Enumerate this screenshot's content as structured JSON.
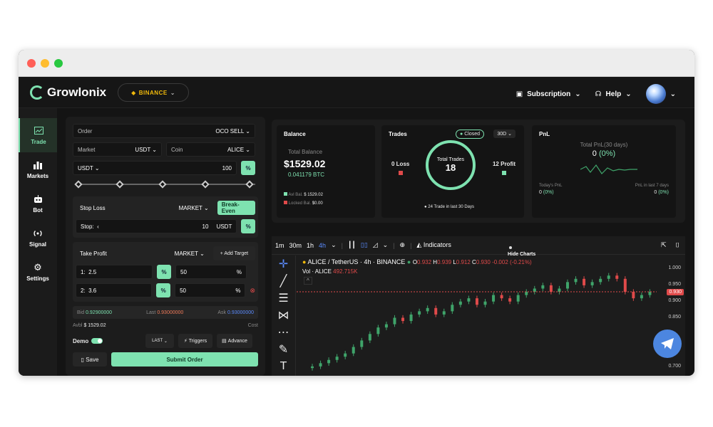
{
  "brand": {
    "name": "Growlonix",
    "exchange": "BINANCE"
  },
  "topbar": {
    "subscription": "Subscription",
    "help": "Help"
  },
  "nav": [
    {
      "label": "Trade",
      "icon": "chart-icon",
      "active": true
    },
    {
      "label": "Markets",
      "icon": "bar-chart-icon",
      "active": false
    },
    {
      "label": "Bot",
      "icon": "robot-icon",
      "active": false
    },
    {
      "label": "Signal",
      "icon": "signal-icon",
      "active": false
    },
    {
      "label": "Settings",
      "icon": "gear-icon",
      "active": false
    }
  ],
  "order": {
    "order_label": "Order",
    "order_type": "OCO SELL",
    "market_label": "Market",
    "market_value": "USDT",
    "coin_label": "Coin",
    "coin_value": "ALICE",
    "amount_unit": "USDT",
    "amount_value": "100",
    "pct": "%",
    "stop_loss_label": "Stop Loss",
    "stop_loss_type": "MARKET",
    "break_even": "Break-Even",
    "stop_label": "Stop:",
    "stop_value": "10",
    "stop_unit": "USDT",
    "take_profit_label": "Take Profit",
    "take_profit_type": "MARKET",
    "add_target": "+ Add Target",
    "targets": [
      {
        "idx": "1:",
        "price": "2.5",
        "amount": "50"
      },
      {
        "idx": "2:",
        "price": "3.6",
        "amount": "50"
      }
    ],
    "bid_label": "Bid",
    "bid": "0.92900000",
    "last_label": "Last",
    "last": "0.93000000",
    "ask_label": "Ask",
    "ask": "0.93000000",
    "avbl_label": "Avbl",
    "avbl": "$ 1529.02",
    "cost_label": "Cost",
    "demo": "Demo",
    "last_btn": "LAST",
    "triggers": "Triggers",
    "advance": "Advance",
    "save": "Save",
    "submit": "Submit Order"
  },
  "balance": {
    "title": "Balance",
    "total_label": "Total Balance",
    "total": "$1529.02",
    "btc": "0.041179 BTC",
    "avl_label": "Avl Bal.",
    "avl": "$ 1529.02",
    "locked_label": "Locked Bal.",
    "locked": "$0.00"
  },
  "trades": {
    "title": "Trades",
    "status": "Closed",
    "period": "30D",
    "loss": "0 Loss",
    "profit": "12 Profit",
    "ring_label": "Total Trades",
    "ring_value": "18",
    "footer": "24 Trade in last 30 Days"
  },
  "pnl": {
    "title": "PnL",
    "total_label": "Total PnL(30 days)",
    "total": "0",
    "total_pct": "(0%)",
    "today_label": "Today's PnL",
    "today": "0",
    "today_pct": "(0%)",
    "last7_label": "PnL in last 7 days",
    "last7": "0",
    "last7_pct": "(0%)"
  },
  "chart": {
    "intervals": [
      "1m",
      "30m",
      "1h",
      "4h"
    ],
    "active_interval": "4h",
    "indicators": "Indicators",
    "hide_charts": "Hide Charts",
    "symbol": "ALICE / TetherUS · 4h · BINANCE",
    "o": "0.932",
    "h": "0.939",
    "l": "0.912",
    "c": "0.930",
    "change": "-0.002 (-0.21%)",
    "vol_label": "Vol · ALICE",
    "vol": "492.715K",
    "yticks": [
      "1.000",
      "0.950",
      "0.900",
      "0.850",
      "0.700"
    ],
    "current_price": "0.930"
  },
  "chart_data": {
    "type": "candlestick",
    "title": "ALICE / TetherUS · 4h · BINANCE",
    "ylim": [
      0.68,
      1.02
    ],
    "last": {
      "open": 0.932,
      "high": 0.939,
      "low": 0.912,
      "close": 0.93
    },
    "closes": [
      0.7,
      0.71,
      0.72,
      0.73,
      0.74,
      0.76,
      0.78,
      0.8,
      0.82,
      0.83,
      0.85,
      0.84,
      0.86,
      0.87,
      0.88,
      0.86,
      0.87,
      0.89,
      0.9,
      0.91,
      0.89,
      0.9,
      0.92,
      0.91,
      0.9,
      0.92,
      0.93,
      0.94,
      0.95,
      0.93,
      0.94,
      0.96,
      0.97,
      0.95,
      0.96,
      0.97,
      0.98,
      0.97,
      0.93,
      0.91,
      0.92,
      0.93
    ]
  }
}
